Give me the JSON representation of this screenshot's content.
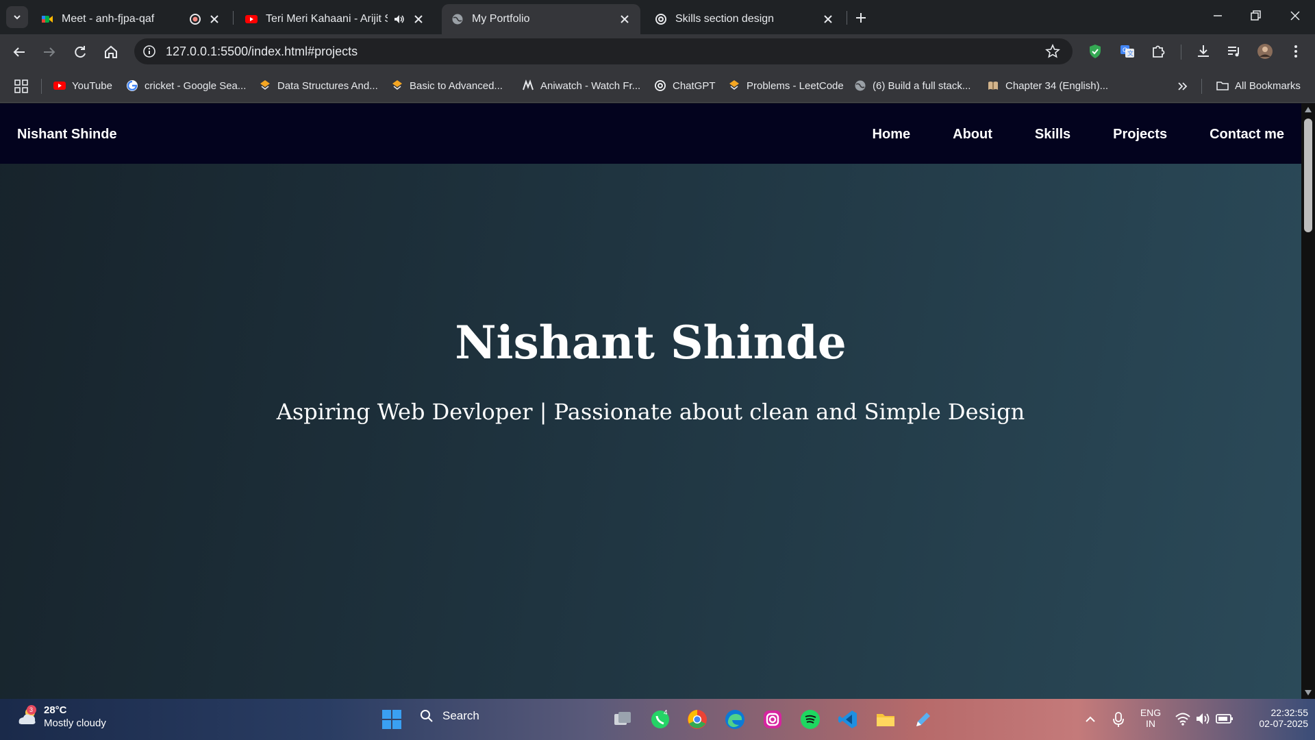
{
  "browser": {
    "tabs": [
      {
        "title": "Meet - anh-fjpa-qaf",
        "icon": "google-meet-icon",
        "extra_icon": "recording-icon"
      },
      {
        "title": "Teri Meri Kahaani - Arijit Sin",
        "icon": "youtube-icon",
        "extra_icon": "speaker-icon"
      },
      {
        "title": "My Portfolio",
        "icon": "globe-icon",
        "active": true
      },
      {
        "title": "Skills section design",
        "icon": "chatgpt-icon"
      }
    ],
    "url": "127.0.0.1:5500/index.html#projects",
    "bookmarks": [
      {
        "label": "YouTube",
        "icon": "youtube-icon"
      },
      {
        "label": "cricket - Google Sea...",
        "icon": "google-icon"
      },
      {
        "label": "Data Structures And...",
        "icon": "code-icon"
      },
      {
        "label": "Basic to Advanced...",
        "icon": "code-icon"
      },
      {
        "label": "Aniwatch - Watch Fr...",
        "icon": "aniwatch-icon"
      },
      {
        "label": "ChatGPT",
        "icon": "chatgpt-icon"
      },
      {
        "label": "Problems - LeetCode",
        "icon": "leetcode-icon"
      },
      {
        "label": "(6) Build a full stack...",
        "icon": "globe-icon"
      },
      {
        "label": "Chapter 34 (English)...",
        "icon": "book-icon"
      }
    ],
    "all_bookmarks": "All Bookmarks"
  },
  "site": {
    "brand": "Nishant Shinde",
    "nav": [
      "Home",
      "About",
      "Skills",
      "Projects",
      "Contact me"
    ],
    "hero_title": "Nishant Shinde",
    "hero_subtitle": "Aspiring Web Devloper | Passionate about clean and Simple Design"
  },
  "taskbar": {
    "weather_badge": "3",
    "temperature": "28°C",
    "condition": "Mostly cloudy",
    "search_placeholder": "Search",
    "whatsapp_badge": "4",
    "lang_top": "ENG",
    "lang_bottom": "IN",
    "time": "22:32:55",
    "date": "02-07-2025"
  },
  "colors": {
    "site_nav_bg": "#03031e",
    "hero_gradient_start": "#17232b",
    "hero_gradient_end": "#2b4a59"
  }
}
